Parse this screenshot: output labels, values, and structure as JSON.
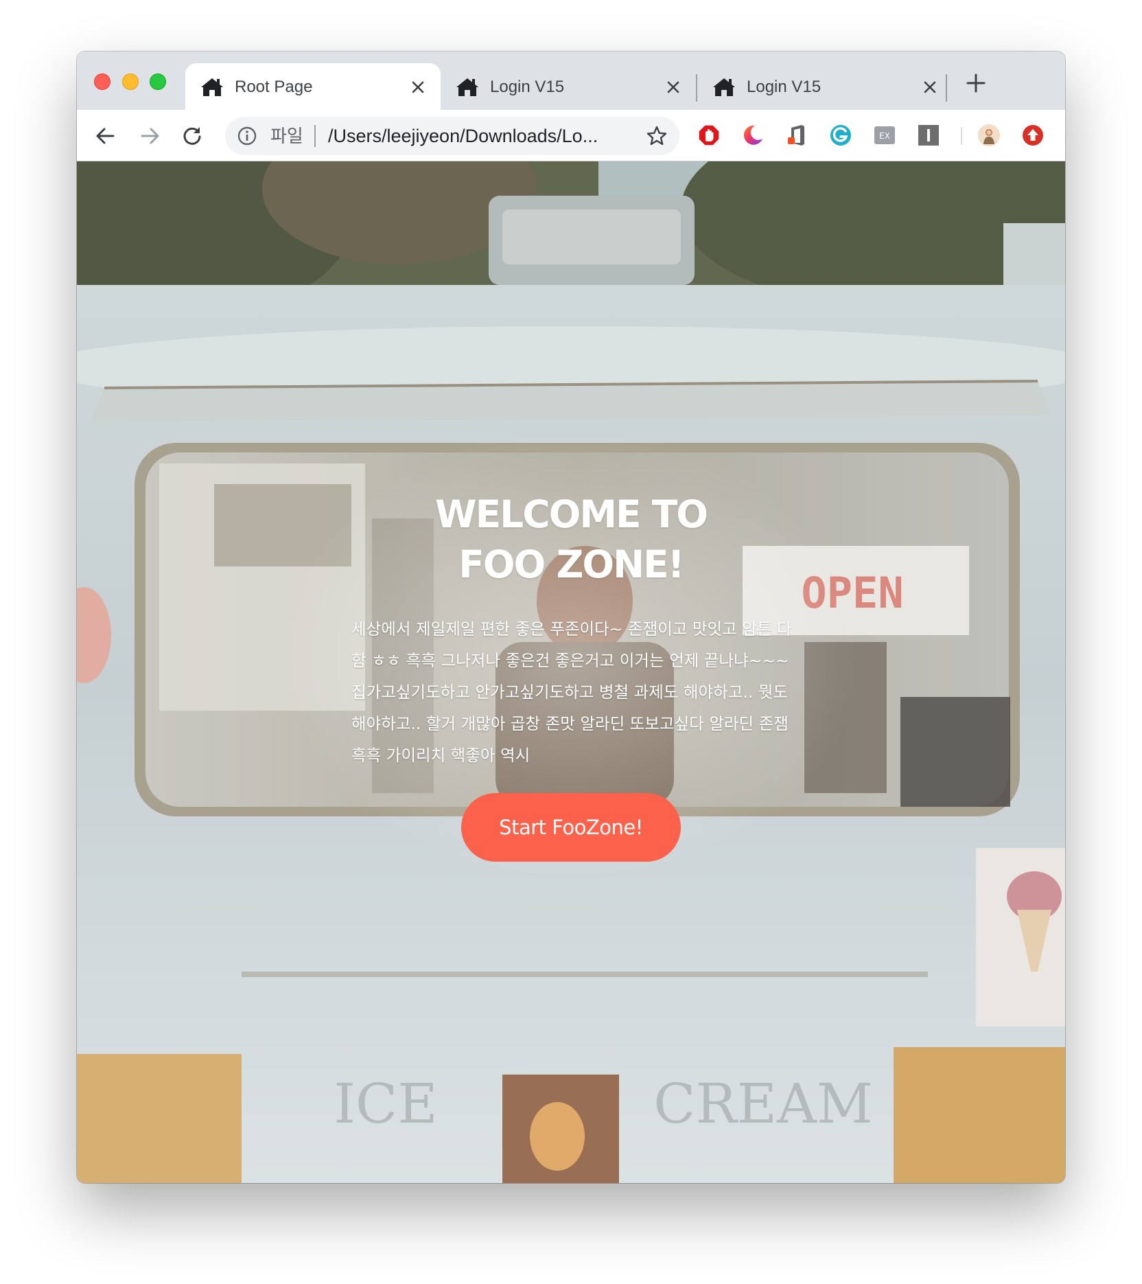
{
  "tabs": [
    {
      "title": "Root Page",
      "active": true
    },
    {
      "title": "Login V15",
      "active": false
    },
    {
      "title": "Login V15",
      "active": false
    }
  ],
  "toolbar": {
    "scheme_label": "파일",
    "url": "/Users/leejiyeon/Downloads/Lo..."
  },
  "extensions": [
    "adblock-icon",
    "night-mode-icon",
    "office-icon",
    "grammarly-icon",
    "ex-icon",
    "instapaper-icon",
    "profile-avatar",
    "upload-icon"
  ],
  "hero": {
    "title_line1": "WELCOME TO",
    "title_line2": "FOO ZONE!",
    "description": "세상에서 제일제일 편한 좋은 푸존이다~ 존잼이고 맛잇고 암튼 다함 ㅎㅎ 흑흑 그나저나 좋은건 좋은거고 이거는 언제 끝나냐~~~ 집가고싶기도하고 안가고싶기도하고 병철 과제도 해야하고.. 뭣도 해야하고.. 할거 개많아 곱창 존맛 알라딘 또보고싶다 알라딘 존잼 흑흑 가이리치 핵좋아 역시",
    "button_label": "Start FooZone!"
  },
  "colors": {
    "accent": "#fb614b",
    "tabstrip": "#dee1e6",
    "omnibox": "#f1f3f4"
  }
}
